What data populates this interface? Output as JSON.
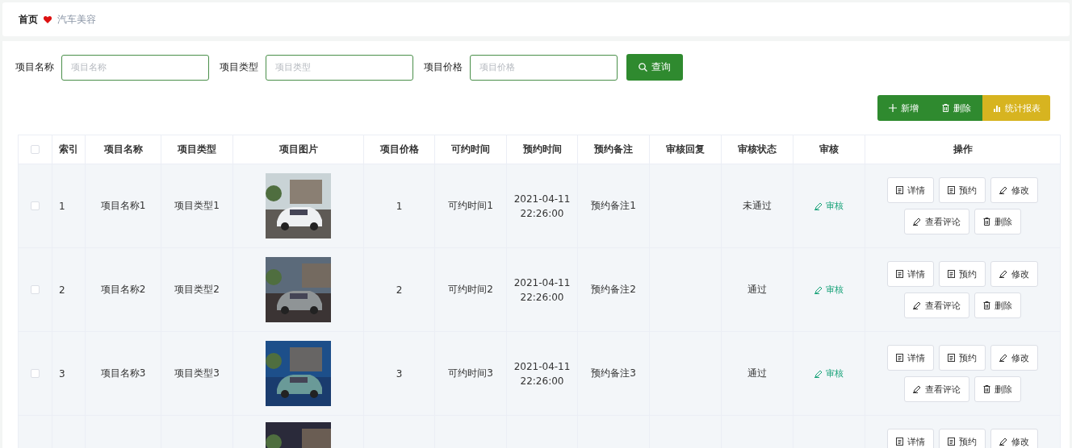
{
  "breadcrumb": {
    "home": "首页",
    "current": "汽车美容"
  },
  "search": [
    {
      "label": "项目名称",
      "placeholder": "项目名称"
    },
    {
      "label": "项目类型",
      "placeholder": "项目类型"
    },
    {
      "label": "项目价格",
      "placeholder": "项目价格"
    }
  ],
  "search_button": "查询",
  "toolbar": [
    {
      "kind": "add",
      "label": "新增"
    },
    {
      "kind": "delete",
      "label": "删除"
    },
    {
      "kind": "chart",
      "label": "统计报表"
    }
  ],
  "table": {
    "select_all": {
      "checked": false
    },
    "columns": [
      "索引",
      "项目名称",
      "项目类型",
      "项目图片",
      "项目价格",
      "可约时间",
      "预约时间",
      "预约备注",
      "审核回复",
      "审核状态",
      "审核",
      "操作"
    ],
    "rows": [
      {
        "checked": false,
        "index": "1",
        "name": "项目名称1",
        "type": "项目类型1",
        "picture": {
          "kind": "picture"
        },
        "price": "1",
        "available": "可约时间1",
        "time": [
          "2021-04-11",
          "22:26:00"
        ],
        "note": "预约备注1",
        "status": "未通过",
        "review": "审核",
        "actions": [
          {
            "kind": "doc",
            "label": "详情"
          },
          {
            "kind": "doc",
            "label": "预约"
          },
          {
            "kind": "edit",
            "label": "修改"
          },
          {
            "kind": "edit",
            "label": "查看评论"
          },
          {
            "kind": "delete",
            "label": "删除"
          }
        ]
      },
      {
        "checked": false,
        "index": "2",
        "name": "项目名称2",
        "type": "项目类型2",
        "picture": {
          "kind": "picture"
        },
        "price": "2",
        "available": "可约时间2",
        "time": [
          "2021-04-11",
          "22:26:00"
        ],
        "note": "预约备注2",
        "status": "通过",
        "review": "审核",
        "actions": [
          {
            "kind": "doc",
            "label": "详情"
          },
          {
            "kind": "doc",
            "label": "预约"
          },
          {
            "kind": "edit",
            "label": "修改"
          },
          {
            "kind": "edit",
            "label": "查看评论"
          },
          {
            "kind": "delete",
            "label": "删除"
          }
        ]
      },
      {
        "checked": false,
        "index": "3",
        "name": "项目名称3",
        "type": "项目类型3",
        "picture": {
          "kind": "picture"
        },
        "price": "3",
        "available": "可约时间3",
        "time": [
          "2021-04-11",
          "22:26:00"
        ],
        "note": "预约备注3",
        "status": "通过",
        "review": "审核",
        "actions": [
          {
            "kind": "doc",
            "label": "详情"
          },
          {
            "kind": "doc",
            "label": "预约"
          },
          {
            "kind": "edit",
            "label": "修改"
          },
          {
            "kind": "edit",
            "label": "查看评论"
          },
          {
            "kind": "delete",
            "label": "删除"
          }
        ]
      },
      {
        "picture": {
          "kind": "picture"
        },
        "actions": [
          {
            "kind": "doc",
            "label": "详情"
          },
          {
            "kind": "doc",
            "label": "预约"
          },
          {
            "kind": "edit",
            "label": "修改"
          }
        ]
      }
    ]
  }
}
